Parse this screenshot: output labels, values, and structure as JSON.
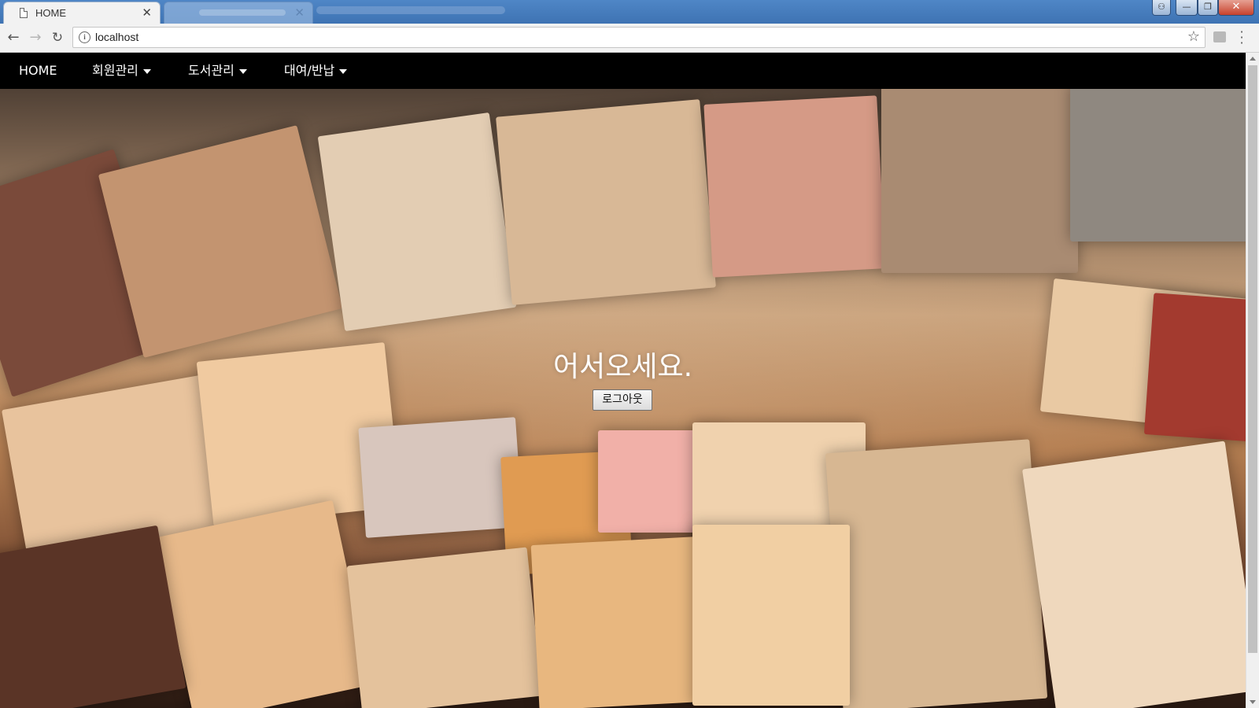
{
  "browser": {
    "tabs": [
      {
        "title": "HOME",
        "active": true
      },
      {
        "title": "",
        "active": false
      }
    ],
    "address": "localhost",
    "window_buttons": [
      "user",
      "minimize",
      "maximize",
      "close"
    ]
  },
  "topnav": {
    "items": [
      {
        "label": "HOME",
        "dropdown": false
      },
      {
        "label": "회원관리",
        "dropdown": true
      },
      {
        "label": "도서관리",
        "dropdown": true
      },
      {
        "label": "대여/반납",
        "dropdown": true
      }
    ]
  },
  "hero": {
    "welcome": "어서오세요.",
    "logout_label": "로그아웃"
  },
  "colors": {
    "nav_bg": "#000000",
    "nav_text": "#ffffff"
  }
}
